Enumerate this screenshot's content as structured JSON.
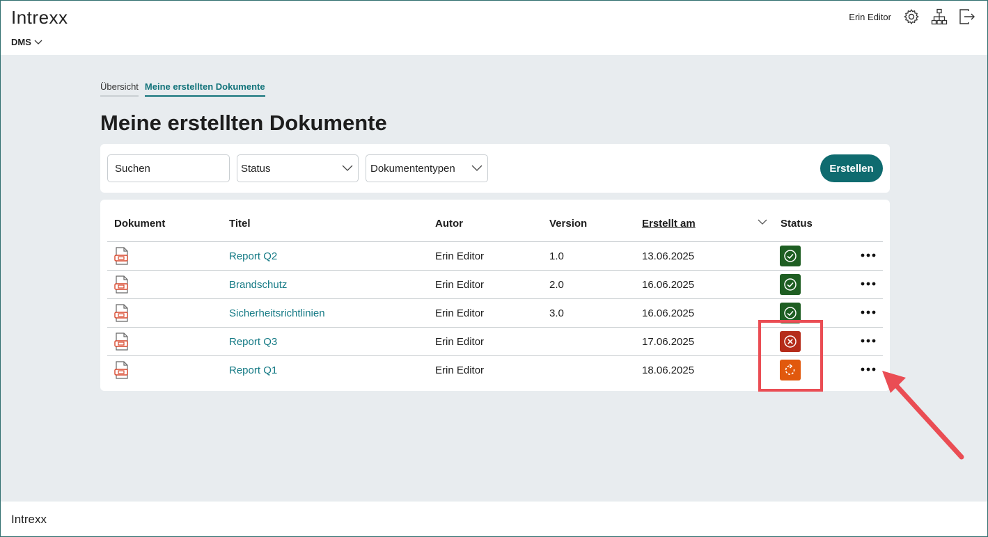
{
  "header": {
    "logo": "Intrexx",
    "app_menu": "DMS",
    "user_name": "Erin Editor",
    "icons": [
      "gear-icon",
      "sitemap-icon",
      "logout-icon"
    ]
  },
  "tabs": [
    {
      "label": "Übersicht",
      "active": false
    },
    {
      "label": "Meine erstellten Dokumente",
      "active": true
    }
  ],
  "page_title": "Meine erstellten Dokumente",
  "filters": {
    "search_placeholder": "Suchen",
    "status_label": "Status",
    "doctype_label": "Dokumententypen",
    "create_label": "Erstellen"
  },
  "table": {
    "columns": [
      "Dokument",
      "Titel",
      "Autor",
      "Version",
      "Erstellt am",
      "Status"
    ],
    "sorted_column": "Erstellt am",
    "rows": [
      {
        "title": "Report Q2",
        "author": "Erin Editor",
        "version": "1.0",
        "created": "13.06.2025",
        "status": "approved"
      },
      {
        "title": "Brandschutz",
        "author": "Erin Editor",
        "version": "2.0",
        "created": "16.06.2025",
        "status": "approved"
      },
      {
        "title": "Sicherheitsrichtlinien",
        "author": "Erin Editor",
        "version": "3.0",
        "created": "16.06.2025",
        "status": "approved"
      },
      {
        "title": "Report Q3",
        "author": "Erin Editor",
        "version": "",
        "created": "17.06.2025",
        "status": "rejected"
      },
      {
        "title": "Report Q1",
        "author": "Erin Editor",
        "version": "",
        "created": "18.06.2025",
        "status": "in-progress"
      }
    ]
  },
  "status_colors": {
    "approved": "#1e5e22",
    "rejected": "#b52c1a",
    "in-progress": "#e1590d"
  },
  "accent_color": "#0f6b6f",
  "annotation_color": "#ea4d54",
  "footer": {
    "logo": "Intrexx"
  }
}
